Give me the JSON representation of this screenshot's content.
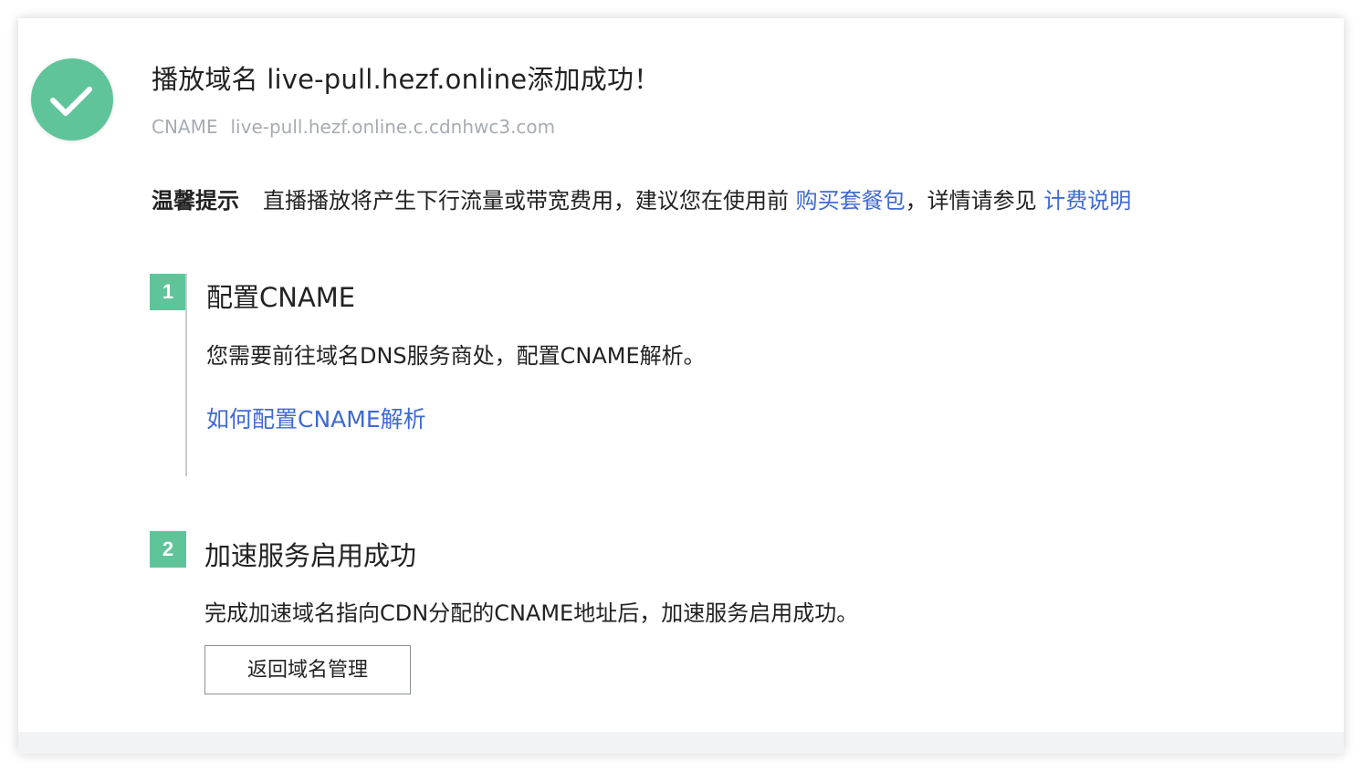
{
  "header": {
    "title": "播放域名 live-pull.hezf.online添加成功！",
    "cname_label": "CNAME",
    "cname_value": "live-pull.hezf.online.c.cdnhwc3.com"
  },
  "tip": {
    "title": "温馨提示",
    "text_before": "直播播放将产生下行流量或带宽费用，建议您在使用前 ",
    "link_buy": "购买套餐包",
    "text_middle": "，详情请参见 ",
    "link_billing": "计费说明"
  },
  "steps": [
    {
      "number": "1",
      "title": "配置CNAME",
      "description": "您需要前往域名DNS服务商处，配置CNAME解析。",
      "link": "如何配置CNAME解析"
    },
    {
      "number": "2",
      "title": "加速服务启用成功",
      "description": "完成加速域名指向CDN分配的CNAME地址后，加速服务启用成功。",
      "button": "返回域名管理"
    }
  ],
  "colors": {
    "accent_green": "#5fc49a",
    "link_blue": "#3f6ad3",
    "muted_text": "#a7abb2",
    "text": "#222222"
  },
  "icons": {
    "success": "check-circle-icon"
  }
}
